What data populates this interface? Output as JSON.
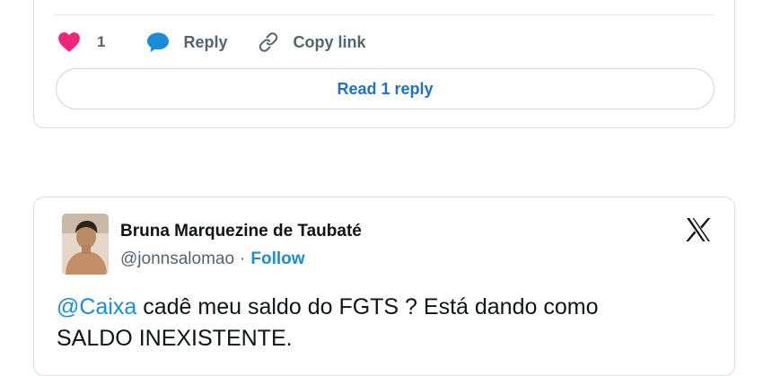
{
  "tweet_top": {
    "like_count": "1",
    "reply_label": "Reply",
    "copy_link_label": "Copy link",
    "read_reply_label": "Read 1 reply",
    "icons": [
      "heart-icon",
      "reply-bubble-icon",
      "link-icon"
    ],
    "colors": {
      "heart": "#f0267b",
      "reply_icon": "#1d8cd6",
      "read_reply": "#1d74c4"
    }
  },
  "tweet_bottom": {
    "author_name": "Bruna Marquezine de Taubaté",
    "handle": "@jonnsalomao",
    "separator": "·",
    "follow_label": "Follow",
    "mention": "@Caixa",
    "text_line1": " cadê meu saldo do FGTS ? Está dando como",
    "text_line2": "SALDO INEXISTENTE.",
    "icons": [
      "x-logo-icon"
    ],
    "colors": {
      "link": "#1d8cd6"
    }
  }
}
